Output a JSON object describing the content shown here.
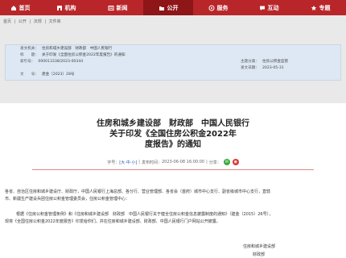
{
  "nav": {
    "items": [
      {
        "label": "首页",
        "icon": "home-icon"
      },
      {
        "label": "机构",
        "icon": "building-icon"
      },
      {
        "label": "新闻",
        "icon": "newspaper-icon"
      },
      {
        "label": "公开",
        "icon": "folder-icon"
      },
      {
        "label": "服务",
        "icon": "service-icon"
      },
      {
        "label": "互动",
        "icon": "chat-icon"
      },
      {
        "label": "专题",
        "icon": "star-icon"
      }
    ],
    "active_index": 3
  },
  "breadcrumb": [
    "首页",
    "|",
    "公开",
    "|",
    "法规",
    "|",
    "文件库"
  ],
  "meta": {
    "fields": [
      {
        "label": "发文机关：",
        "value": "住房和城乡建设部　财政部　中国人民银行"
      },
      {
        "label": "标　　题：",
        "value": "关于印发《全国住房公积金2022年度报告》的通知"
      },
      {
        "label": "索引号：",
        "value": "000013338/2023-00344"
      },
      {
        "label": "主题分类：",
        "value": "住房公积金监管"
      },
      {
        "label": "发文日期：",
        "value": "2023-05-31"
      },
      {
        "label": "文　　号：",
        "value": "建金〔2023〕28号"
      }
    ]
  },
  "doc": {
    "title_line1": "住房和城乡建设部　财政部　中国人民银行",
    "title_line2": "关于印发《全国住房公积金2022年",
    "title_line3": "度报告》的通知",
    "font_label": "字号：",
    "font_sizes": "[大·中·小]",
    "pub_label": "发布时间：",
    "pub_time": "2023-06-08 16:00:00",
    "share_label": "分享：",
    "para1": "各省、自治区住房和城乡建设厅、财政厅，中国人民银行上海总部、各分行、营业管理部、各省会（首府）城市中心支行、副省级城市中心支行，直辖",
    "para1b": "市、新疆生产建设兵团住房公积金管理委员会，住房公积金管理中心：",
    "para2": "根据《住房公积金管理条例》和《住房和城乡建设部　财政部　中国人民银行关于健全住房公积金信息披露制度的通知》（建金〔2015〕26号），",
    "para2b": "现将《全国住房公积金2022年度报告》印发给你们，并在住房和城乡建设部、财政部、中国人民银行门户网站公开披露。",
    "sign1": "住房和城乡建设部",
    "sign2": "财政部"
  },
  "colors": {
    "nav_bg": "#b8262a",
    "nav_active": "#8e1518",
    "meta_bg": "#dde8f4",
    "wechat": "#3aa83a",
    "weibo": "#d33"
  }
}
